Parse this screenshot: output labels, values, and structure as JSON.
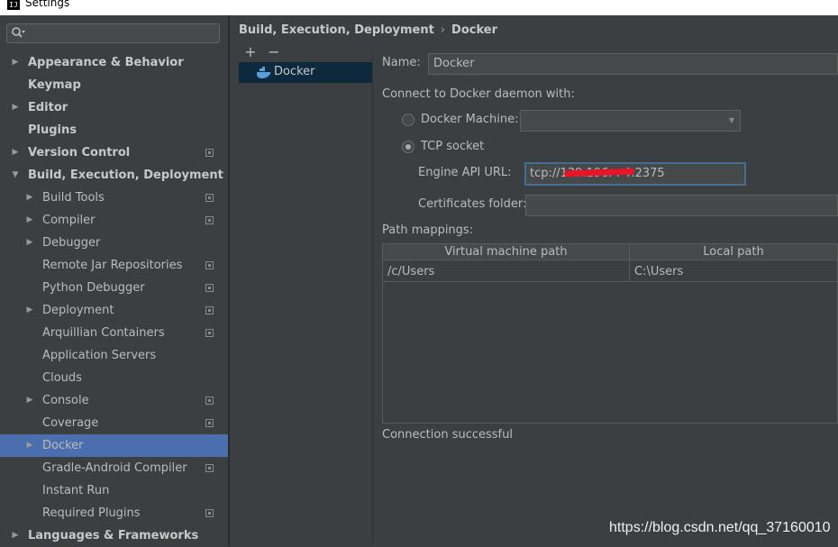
{
  "window": {
    "title": "Settings"
  },
  "search": {
    "placeholder": "",
    "value": ""
  },
  "sidebar": {
    "items": [
      {
        "label": "Appearance & Behavior",
        "level": 0,
        "arrow": "right",
        "bold": true,
        "project_icon": false
      },
      {
        "label": "Keymap",
        "level": 0,
        "arrow": "none",
        "bold": true,
        "project_icon": false
      },
      {
        "label": "Editor",
        "level": 0,
        "arrow": "right",
        "bold": true,
        "project_icon": false
      },
      {
        "label": "Plugins",
        "level": 0,
        "arrow": "none",
        "bold": true,
        "project_icon": false
      },
      {
        "label": "Version Control",
        "level": 0,
        "arrow": "right",
        "bold": true,
        "project_icon": true
      },
      {
        "label": "Build, Execution, Deployment",
        "level": 0,
        "arrow": "down",
        "bold": true,
        "project_icon": false
      },
      {
        "label": "Build Tools",
        "level": 1,
        "arrow": "right",
        "bold": false,
        "project_icon": true
      },
      {
        "label": "Compiler",
        "level": 1,
        "arrow": "right",
        "bold": false,
        "project_icon": true
      },
      {
        "label": "Debugger",
        "level": 1,
        "arrow": "right",
        "bold": false,
        "project_icon": false
      },
      {
        "label": "Remote Jar Repositories",
        "level": 1,
        "arrow": "none",
        "bold": false,
        "project_icon": true
      },
      {
        "label": "Python Debugger",
        "level": 1,
        "arrow": "none",
        "bold": false,
        "project_icon": true
      },
      {
        "label": "Deployment",
        "level": 1,
        "arrow": "right",
        "bold": false,
        "project_icon": true
      },
      {
        "label": "Arquillian Containers",
        "level": 1,
        "arrow": "none",
        "bold": false,
        "project_icon": true
      },
      {
        "label": "Application Servers",
        "level": 1,
        "arrow": "none",
        "bold": false,
        "project_icon": false
      },
      {
        "label": "Clouds",
        "level": 1,
        "arrow": "none",
        "bold": false,
        "project_icon": false
      },
      {
        "label": "Console",
        "level": 1,
        "arrow": "right",
        "bold": false,
        "project_icon": true
      },
      {
        "label": "Coverage",
        "level": 1,
        "arrow": "none",
        "bold": false,
        "project_icon": true
      },
      {
        "label": "Docker",
        "level": 1,
        "arrow": "right",
        "bold": false,
        "project_icon": false,
        "selected": true
      },
      {
        "label": "Gradle-Android Compiler",
        "level": 1,
        "arrow": "none",
        "bold": false,
        "project_icon": true
      },
      {
        "label": "Instant Run",
        "level": 1,
        "arrow": "none",
        "bold": false,
        "project_icon": false
      },
      {
        "label": "Required Plugins",
        "level": 1,
        "arrow": "none",
        "bold": false,
        "project_icon": true
      },
      {
        "label": "Languages & Frameworks",
        "level": 0,
        "arrow": "right",
        "bold": true,
        "project_icon": false
      }
    ]
  },
  "breadcrumb": {
    "section": "Build, Execution, Deployment",
    "separator": "›",
    "page": "Docker"
  },
  "toolbar": {
    "add_label": "+",
    "remove_label": "−"
  },
  "docker_list": {
    "items": [
      {
        "label": "Docker",
        "icon": "docker-whale-icon"
      }
    ]
  },
  "form": {
    "name_label": "Name:",
    "name_value": "Docker",
    "connect_label": "Connect to Docker daemon with:",
    "docker_machine_label": "Docker Machine:",
    "docker_machine_value": "",
    "tcp_socket_label": "TCP socket",
    "engine_api_label": "Engine API URL:",
    "engine_api_value": "tcp://139.196.  .  4:2375",
    "certificates_label": "Certificates folder:",
    "certificates_value": "",
    "path_mappings_label": "Path mappings:",
    "table": {
      "columns": [
        "Virtual machine path",
        "Local path"
      ],
      "rows": [
        [
          "/c/Users",
          "C:\\Users"
        ]
      ]
    },
    "status": "Connection successful"
  },
  "watermark": "https://blog.csdn.net/qq_37160010",
  "colors": {
    "background": "#3c3f41",
    "selection": "#4b6eaf",
    "list_selection": "#0d293e",
    "focus_border": "#466d94",
    "redaction": "#e8142a"
  }
}
